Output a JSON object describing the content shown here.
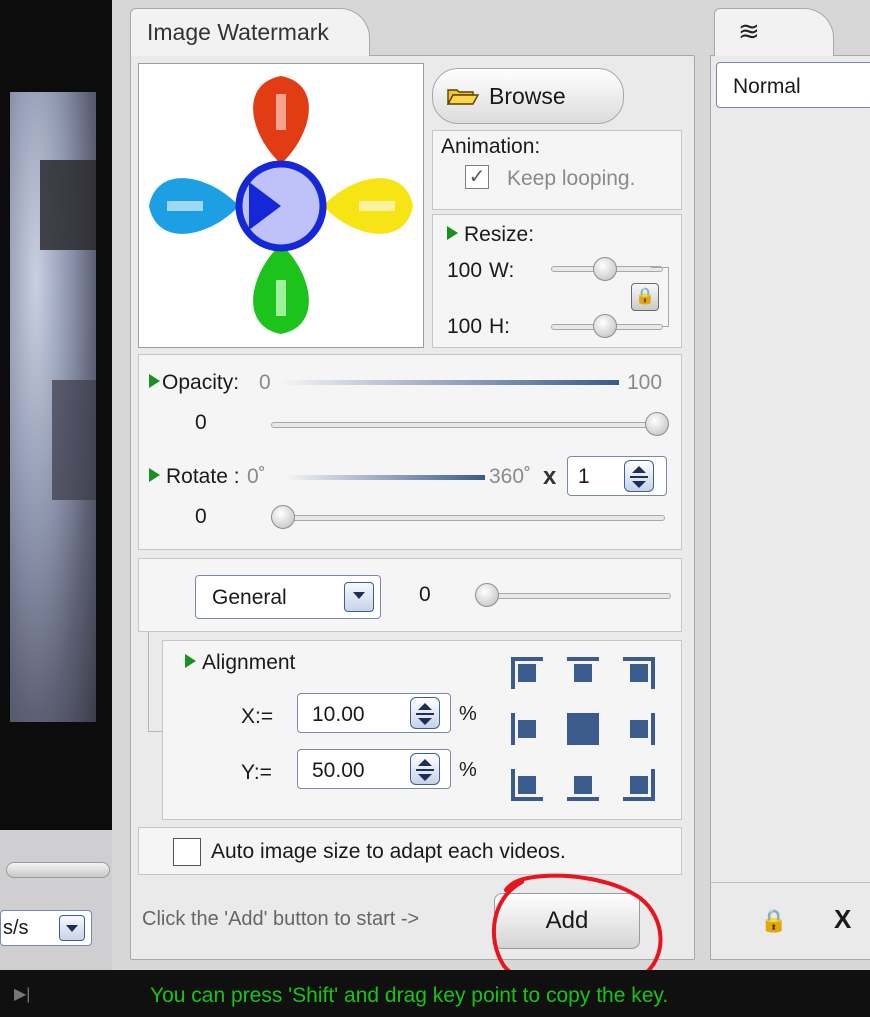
{
  "panel": {
    "tab_label": "Image Watermark",
    "browse_label": "Browse",
    "animation": {
      "label": "Animation:",
      "keep_looping_label": "Keep looping.",
      "keep_looping_checked": true
    },
    "resize": {
      "label": "Resize:",
      "width_value": "100",
      "width_label": "W:",
      "height_value": "100",
      "height_label": "H:",
      "width_level": 0.6,
      "height_level": 0.6,
      "locked": true
    },
    "opacity": {
      "label": "Opacity:",
      "min": "0",
      "max": "100",
      "value": "0",
      "level": 1.0
    },
    "rotate": {
      "label": "Rotate :",
      "min": "0˚",
      "max": "360˚",
      "times_sign": "x",
      "times_value": "1",
      "value": "0",
      "level": 0.0
    },
    "effect": {
      "selected": "General",
      "value": "0",
      "level": 0.0
    },
    "alignment": {
      "label": "Alignment",
      "x_label": "X:=",
      "x_value": "10.00",
      "y_label": "Y:=",
      "y_value": "50.00",
      "unit": "%"
    },
    "auto_size": {
      "label": "Auto image size to adapt each videos.",
      "checked": false
    },
    "hint": "Click the 'Add' button to start ->",
    "add_label": "Add"
  },
  "left": {
    "select_value": "s/s"
  },
  "right": {
    "select_value": "Normal",
    "delete_label": "X"
  },
  "status": {
    "hint": "You can press 'Shift' and drag key point to copy the key."
  },
  "colors": {
    "accent": "#3b5b8c",
    "annotation": "#e8141e",
    "status_text": "#19c419"
  },
  "icons": [
    "folder-icon",
    "lock-icon",
    "dropdown-arrow-icon",
    "spin-icon",
    "layers-icon",
    "play-icon"
  ]
}
